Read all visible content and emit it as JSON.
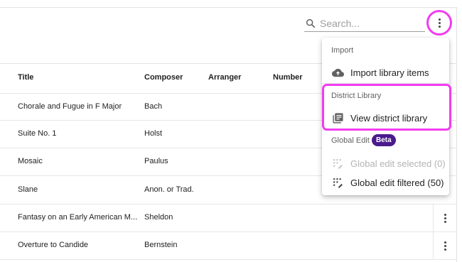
{
  "search": {
    "placeholder": "Search..."
  },
  "table": {
    "headers": {
      "title": "Title",
      "composer": "Composer",
      "arranger": "Arranger",
      "number": "Number"
    },
    "rows": [
      {
        "title": "Chorale and Fugue in F Major",
        "composer": "Bach"
      },
      {
        "title": "Suite No. 1",
        "composer": "Holst"
      },
      {
        "title": "Mosaic",
        "composer": "Paulus"
      },
      {
        "title": "Slane",
        "composer": "Anon. or Trad."
      },
      {
        "title": "Fantasy on an Early American M...",
        "composer": "Sheldon"
      },
      {
        "title": "Overture to Candide",
        "composer": "Bernstein"
      }
    ]
  },
  "menu": {
    "import_header": "Import",
    "import_items": "Import library items",
    "district_header": "District Library",
    "view_district": "View district library",
    "global_header": "Global Edit",
    "beta": "Beta",
    "edit_selected": "Global edit selected (0)",
    "edit_filtered": "Global edit filtered (50)"
  },
  "colors": {
    "highlight": "#f23cf0",
    "beta_badge": "#4a1b8d"
  },
  "icons": [
    "search-icon",
    "more-vert-icon",
    "cloud-upload-icon",
    "library-books-icon",
    "grid-edit-icon"
  ]
}
